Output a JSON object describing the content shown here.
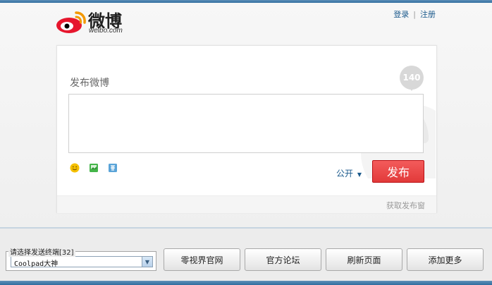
{
  "header": {
    "brand_cn": "微博",
    "brand_en": "weibo.com",
    "login_label": "登录",
    "register_label": "注册"
  },
  "composer": {
    "title": "发布微博",
    "counter": "140",
    "visibility_label": "公开",
    "publish_label": "发布",
    "footer_link": "获取发布窗"
  },
  "bottom": {
    "terminal_label": "请选择发送终端[32]",
    "terminal_selected": "Coolpad大神",
    "buttons": {
      "official_site": "零视界官网",
      "official_forum": "官方论坛",
      "refresh_page": "刷新页面",
      "add_more": "添加更多"
    }
  },
  "colors": {
    "accent_blue": "#1b5a8c",
    "publish_red": "#e23a3a",
    "border_gray": "#cfcfcf"
  },
  "icons": {
    "emoji": "smiley-face-icon",
    "image": "image-icon",
    "topic": "topic-tag-icon",
    "logo": "weibo-logo-icon",
    "dropdown": "chevron-down-icon"
  }
}
